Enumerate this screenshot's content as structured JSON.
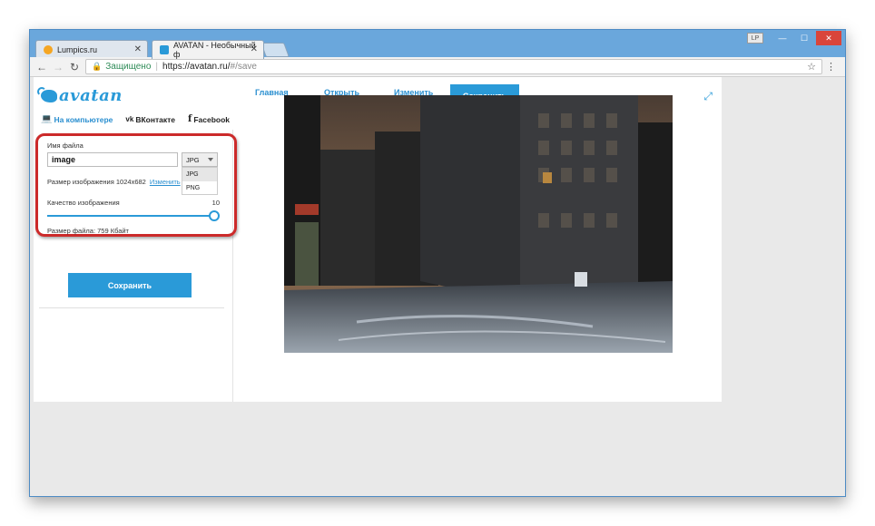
{
  "browser": {
    "tabs": [
      {
        "title": "Lumpics.ru",
        "favicon_color": "#f5a623"
      },
      {
        "title": "AVATAN - Необычный ф",
        "favicon_color": "#2a9ad8"
      }
    ],
    "user_badge": "LP",
    "security_label": "Защищено",
    "url_host": "https://avatan.ru/",
    "url_path": "#/save"
  },
  "avatan": {
    "logo_text": "avatan",
    "nav": {
      "home": "Главная",
      "open": "Открыть",
      "edit": "Изменить",
      "save": "Сохранить"
    },
    "subnav": {
      "computer": "На компьютере",
      "vk": "ВКонтакте",
      "facebook": "Facebook"
    },
    "settings": {
      "filename_label": "Имя файла",
      "filename_value": "image",
      "format_selected": "JPG",
      "format_options": [
        "JPG",
        "PNG"
      ],
      "size_label": "Размер изображения 1024x682",
      "size_change_link": "Изменить",
      "quality_label": "Качество изображения",
      "quality_value": "10",
      "filesize_label": "Размер файла: 759 Кбайт"
    },
    "save_button": "Сохранить"
  },
  "colors": {
    "accent": "#2a9ad8",
    "highlight_border": "#cc2a2a"
  }
}
